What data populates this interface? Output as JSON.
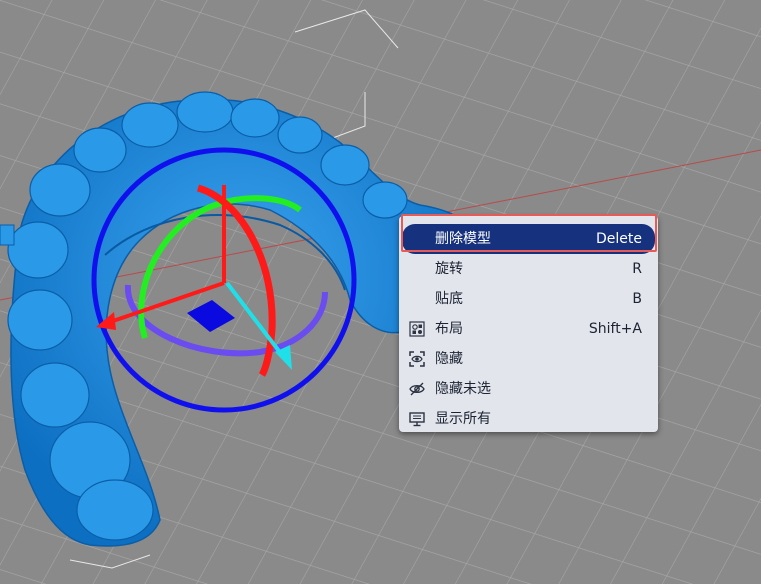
{
  "viewport": {
    "background": "#8a8a8a",
    "model_color": "#1b86d8",
    "gizmo": {
      "ring_color": "#1010ee",
      "x_axis_color": "#ff1a1a",
      "y_axis_color": "#22ee22",
      "z_axis_color": "#1fe0e8",
      "plane_handle_color": "#0a0ae0"
    }
  },
  "context_menu": {
    "items": [
      {
        "label": "删除模型",
        "shortcut": "Delete",
        "icon": "",
        "active": true
      },
      {
        "label": "旋转",
        "shortcut": "R",
        "icon": ""
      },
      {
        "label": "贴底",
        "shortcut": "B",
        "icon": ""
      },
      {
        "label": "布局",
        "shortcut": "Shift+A",
        "icon": "arrange-icon"
      },
      {
        "label": "隐藏",
        "shortcut": "",
        "icon": "hide-icon"
      },
      {
        "label": "隐藏未选",
        "shortcut": "",
        "icon": "eye-icon"
      },
      {
        "label": "显示所有",
        "shortcut": "",
        "icon": "monitor-icon"
      }
    ],
    "highlight_color": "#e85a55",
    "active_color": "#16327e"
  }
}
